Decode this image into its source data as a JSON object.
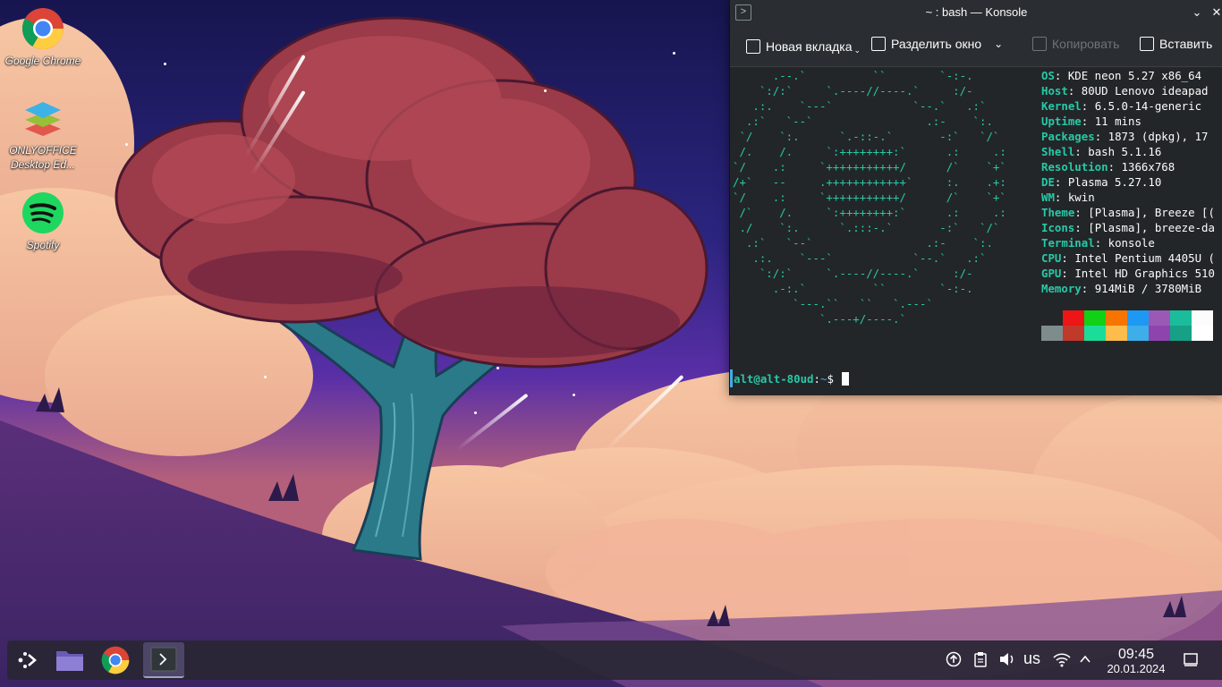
{
  "desktop": {
    "icons": [
      {
        "label": "Google Chrome"
      },
      {
        "label": "ONLYOFFICE Desktop Ed..."
      },
      {
        "label": "Spotify"
      }
    ]
  },
  "konsole": {
    "title": "~ : bash — Konsole",
    "toolbar": {
      "new_tab": "Новая вкладка",
      "split_view": "Разделить окно",
      "copy": "Копировать",
      "paste": "Вставить"
    },
    "logo_lines": [
      "      .--.`          ``        `-:-.",
      "    `:/:`     `.----//----.`     :/-",
      "   .:.    `---`            `--.`   .:`",
      "  .:`   `--`                 .:-    `:.",
      " `/    `:.      `.-::-.`       -:`   `/`",
      " /.    /.     `:++++++++:`      .:     .:",
      "`/    .:     `+++++++++++/      /`    `+`",
      "/+`   --     .++++++++++++`     :.    .+:",
      "`/    .:     `+++++++++++/      /`    `+`",
      " /`    /.     `:++++++++:`      .:     .:",
      " ./    `:.      `.:::-.`       -:`   `/`",
      "  .:`   `--`                 .:-    `:.",
      "   .:.    `---`            `--.`   .:`",
      "    `:/:`     `.----//----.`     :/-",
      "      .-:.`          ``        `-:-.",
      "         `---.``   ``   `.---`",
      "             `.---+/----.`"
    ],
    "info": [
      {
        "key": "OS",
        "value": "KDE neon 5.27 x86_64"
      },
      {
        "key": "Host",
        "value": "80UD Lenovo ideapad"
      },
      {
        "key": "Kernel",
        "value": "6.5.0-14-generic"
      },
      {
        "key": "Uptime",
        "value": "11 mins"
      },
      {
        "key": "Packages",
        "value": "1873 (dpkg), 17"
      },
      {
        "key": "Shell",
        "value": "bash 5.1.16"
      },
      {
        "key": "Resolution",
        "value": "1366x768"
      },
      {
        "key": "DE",
        "value": "Plasma 5.27.10"
      },
      {
        "key": "WM",
        "value": "kwin"
      },
      {
        "key": "Theme",
        "value": "[Plasma], Breeze [("
      },
      {
        "key": "Icons",
        "value": "[Plasma], breeze-da"
      },
      {
        "key": "Terminal",
        "value": "konsole"
      },
      {
        "key": "CPU",
        "value": "Intel Pentium 4405U ("
      },
      {
        "key": "GPU",
        "value": "Intel HD Graphics 510"
      },
      {
        "key": "Memory",
        "value": "914MiB / 3780MiB"
      }
    ],
    "palette_top": [
      "#232629",
      "#ed1515",
      "#11d116",
      "#f67400",
      "#1d99f3",
      "#9b59b6",
      "#1abc9c",
      "#fcfcfc"
    ],
    "palette_bottom": [
      "#7f8c8d",
      "#c0392b",
      "#1cdc9a",
      "#fdbc4b",
      "#3daee9",
      "#8e44ad",
      "#16a085",
      "#ffffff"
    ],
    "prompt": {
      "user": "alt@alt-80ud",
      "sep": ":",
      "path": "~",
      "symbol": "$ "
    }
  },
  "taskbar": {
    "tray": {
      "keyboard_layout": "us",
      "time": "09:45",
      "date": "20.01.2024"
    }
  },
  "colors": {
    "accent": "#3daee9",
    "terminal_green": "#27c9a7",
    "terminal_bg": "#232629"
  }
}
